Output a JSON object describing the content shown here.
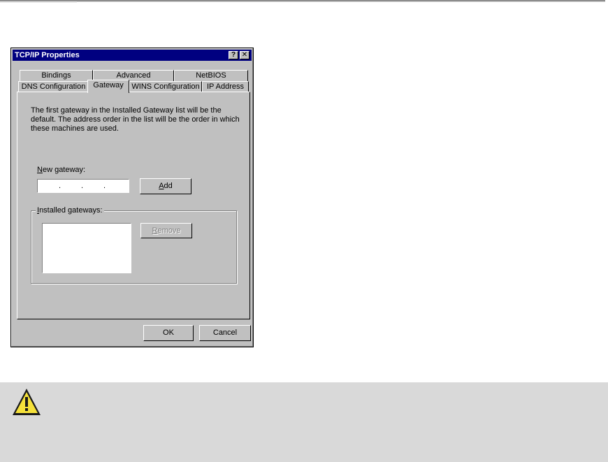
{
  "dialog": {
    "title": "TCP/IP Properties",
    "help_button": "?",
    "close_button": "✕",
    "tabs_back": [
      {
        "label": "Bindings"
      },
      {
        "label": "Advanced"
      },
      {
        "label": "NetBIOS"
      }
    ],
    "tabs_front": [
      {
        "label": "DNS Configuration"
      },
      {
        "label": "Gateway"
      },
      {
        "label": "WINS Configuration"
      },
      {
        "label": "IP Address"
      }
    ],
    "active_tab": "Gateway",
    "description": "The first gateway in the Installed Gateway list will be the default. The address order in the list will be the order in which these machines are used.",
    "new_gateway": {
      "label_access": "N",
      "label_rest": "ew gateway:",
      "value": ""
    },
    "add_button": {
      "access": "A",
      "rest": "dd"
    },
    "installed_gateways": {
      "access": "I",
      "rest": "nstalled gateways:",
      "items": []
    },
    "remove_button": {
      "access": "R",
      "rest": "emove"
    },
    "ok_button": "OK",
    "cancel_button": "Cancel"
  },
  "caution": {
    "icon": "warning-icon",
    "color": "#d9d9d9"
  }
}
